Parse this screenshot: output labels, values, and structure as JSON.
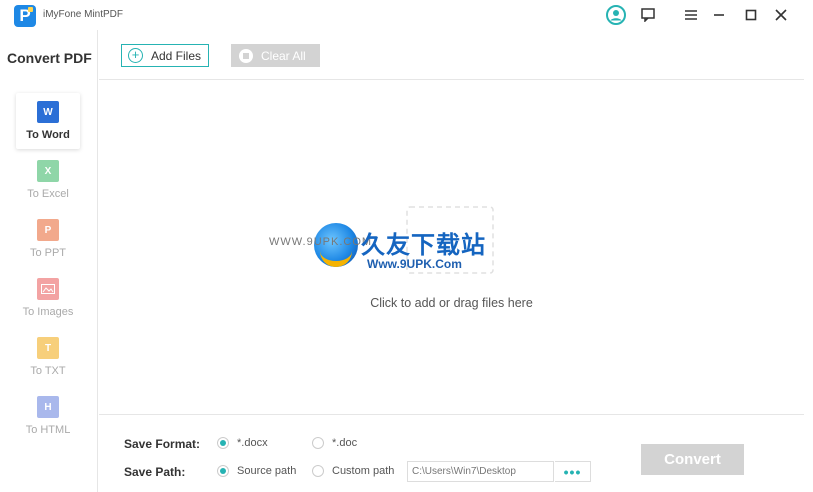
{
  "app": {
    "logo_letter": "P",
    "title": "iMyFone MintPDF"
  },
  "sidebar": {
    "title": "Convert PDF",
    "items": [
      {
        "label": "To Word",
        "icon": "word-icon",
        "icon_letter": "W",
        "color": "#2b6fd6"
      },
      {
        "label": "To Excel",
        "icon": "excel-icon",
        "icon_letter": "X",
        "color": "#8fd6a8"
      },
      {
        "label": "To PPT",
        "icon": "ppt-icon",
        "icon_letter": "P",
        "color": "#f2a98c"
      },
      {
        "label": "To Images",
        "icon": "image-icon",
        "icon_letter": "",
        "color": "#f3a3a3"
      },
      {
        "label": "To TXT",
        "icon": "txt-icon",
        "icon_letter": "T",
        "color": "#f7cf7b"
      },
      {
        "label": "To HTML",
        "icon": "html-icon",
        "icon_letter": "H",
        "color": "#a9b8ec"
      }
    ]
  },
  "toolbar": {
    "add_files": "Add Files",
    "clear_all": "Clear All"
  },
  "drop_area": {
    "hint": "Click to add or drag files here"
  },
  "watermark": {
    "left_url": "WWW.9UPK.COM",
    "title": "久友下载站",
    "url": "Www.9UPK.Com"
  },
  "settings": {
    "save_format_label": "Save Format:",
    "formats": [
      "*.docx",
      "*.doc"
    ],
    "save_path_label": "Save Path:",
    "path_options": [
      "Source path",
      "Custom path"
    ],
    "path_value": "C:\\Users\\Win7\\Desktop",
    "browse": "•••"
  },
  "convert": "Convert",
  "colors": {
    "accent": "#26b3b3",
    "disabled": "#d3d3d3"
  }
}
